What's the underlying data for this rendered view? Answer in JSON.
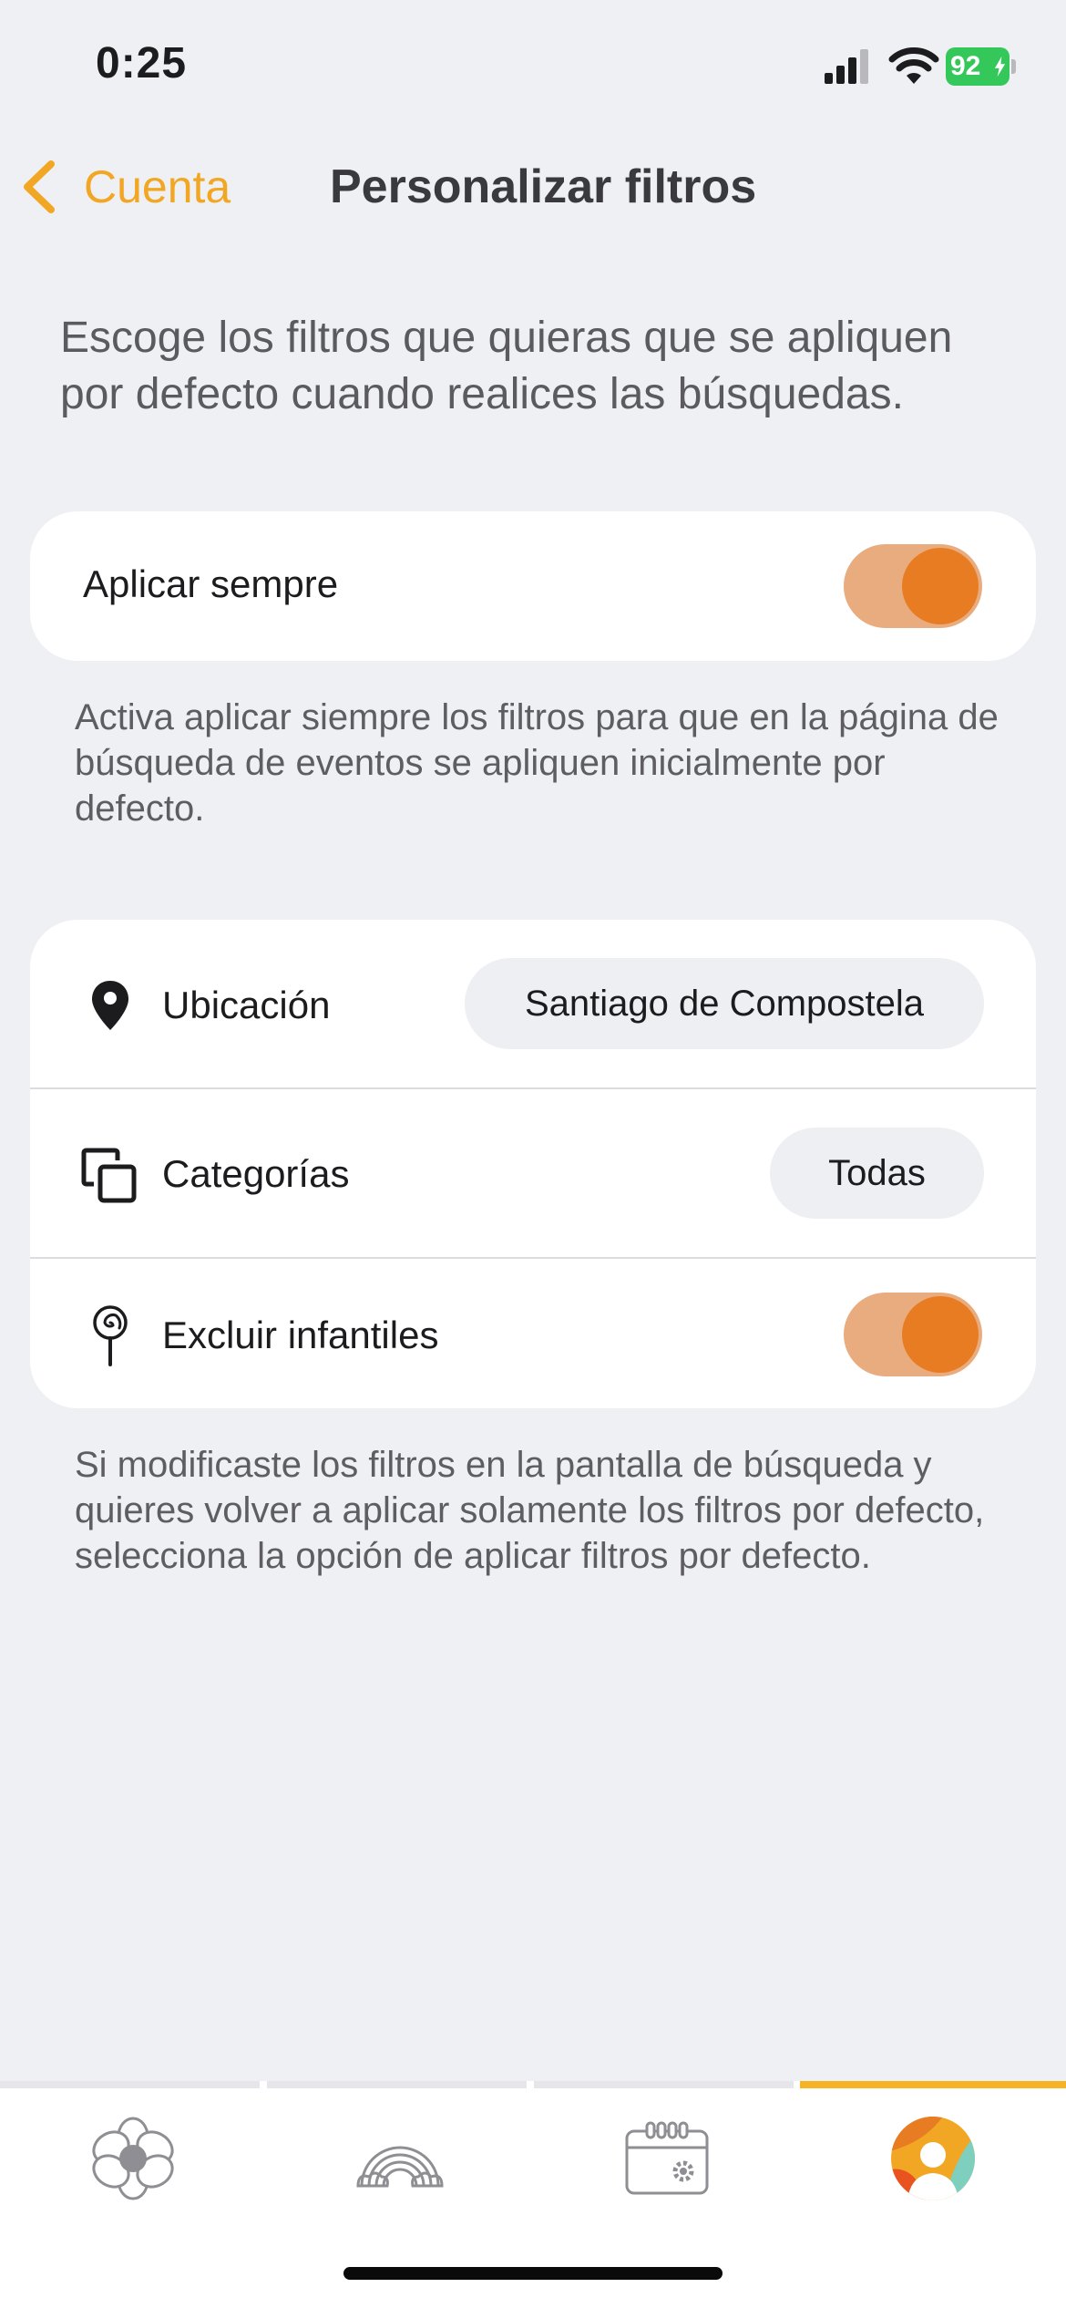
{
  "status_bar": {
    "time": "0:25",
    "battery": "92"
  },
  "nav": {
    "back_label": "Cuenta",
    "title": "Personalizar filtros"
  },
  "intro": "Escoge los filtros que quieras que se apliquen por defecto cuando realices las búsquedas.",
  "always_apply": {
    "label": "Aplicar sempre",
    "enabled": true
  },
  "always_apply_note": "Activa aplicar siempre los filtros para que en la página de búsqueda de eventos se apliquen inicialmente por defecto.",
  "filters": {
    "location": {
      "label": "Ubicación",
      "value": "Santiago de Compostela",
      "icon": "map-pin-icon"
    },
    "categories": {
      "label": "Categorías",
      "value": "Todas",
      "icon": "copy-squares-icon"
    },
    "exclude_kids": {
      "label": "Excluir infantiles",
      "enabled": true,
      "icon": "lollipop-icon"
    }
  },
  "filters_note": "Si modificaste los filtros en la pantalla de búsqueda y quieres volver a aplicar solamente los filtros por defecto, selecciona la opción de aplicar filtros por defecto.",
  "tabbar": {
    "active_index": 3,
    "tabs": [
      {
        "icon": "flower-icon"
      },
      {
        "icon": "rainbow-icon"
      },
      {
        "icon": "calendar-settings-icon"
      },
      {
        "icon": "profile-avatar-icon"
      }
    ]
  },
  "colors": {
    "accent": "#f2a724",
    "toggle_track": "#e9ac7e",
    "toggle_knob": "#e87c22",
    "background": "#eff0f4"
  }
}
